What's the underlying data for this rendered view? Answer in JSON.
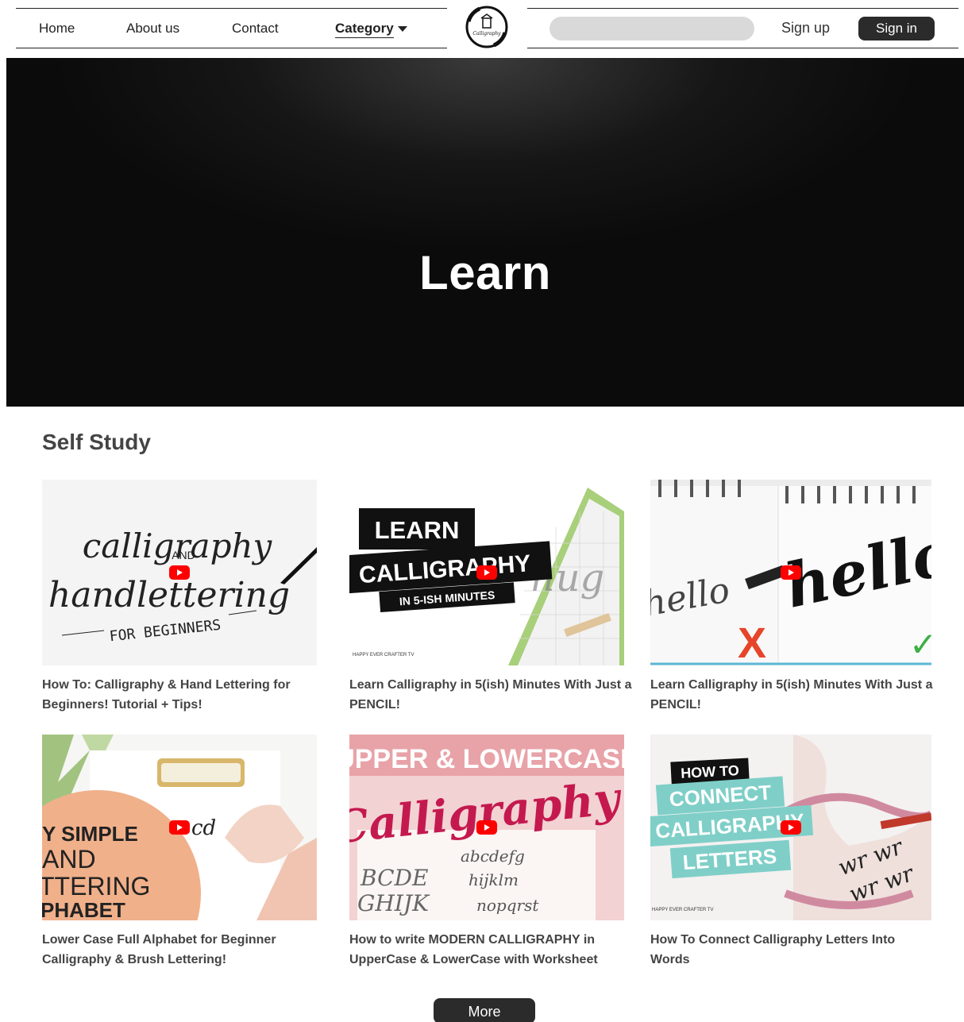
{
  "nav": {
    "home": "Home",
    "about": "About us",
    "contact": "Contact",
    "category": "Category"
  },
  "logo": {
    "text": "Calligraphy"
  },
  "search": {
    "placeholder": ""
  },
  "auth": {
    "signup": "Sign up",
    "signin": "Sign in"
  },
  "hero": {
    "title": "Learn"
  },
  "section": {
    "title": "Self Study"
  },
  "videos": [
    {
      "title": "How To: Calligraphy & Hand Lettering for Beginners! Tutorial + Tips!",
      "thumb_lines": [
        "calligraphy",
        "AND",
        "handlettering",
        "FOR BEGINNERS"
      ]
    },
    {
      "title": "Learn Calligraphy in 5(ish) Minutes With Just a PENCIL!",
      "thumb_lines": [
        "LEARN",
        "CALLIGRAPHY",
        "IN 5-ISH MINUTES",
        "HAPPY EVER CRAFTER TV",
        "hug"
      ]
    },
    {
      "title": "Learn Calligraphy in 5(ish) Minutes With Just a PENCIL!",
      "thumb_lines": [
        "hello",
        "hello",
        "X",
        "✓"
      ]
    },
    {
      "title": "Lower Case Full Alphabet for Beginner Calligraphy & Brush Lettering!",
      "thumb_lines": [
        "Y SIMPLE",
        "AND",
        "TTERING",
        "PHABET",
        "cd"
      ]
    },
    {
      "title": "How to write MODERN CALLIGRAPHY in UpperCase & LowerCase with Worksheet",
      "thumb_lines": [
        "UPPER & LOWERCASE",
        "Calligraphy",
        "abcdefg",
        "hijklm",
        "nopqrst"
      ]
    },
    {
      "title": "How To Connect Calligraphy Letters Into Words",
      "thumb_lines": [
        "HOW TO",
        "CONNECT",
        "CALLIGRAPHY",
        "LETTERS",
        "wr wr",
        "wr wr",
        "HAPPY EVER CRAFTER TV"
      ]
    }
  ],
  "more": "More",
  "colors": {
    "dark": "#2b2b2b",
    "play": "#ff0000",
    "teal": "#7fcfc8",
    "peach": "#f0b08a"
  }
}
